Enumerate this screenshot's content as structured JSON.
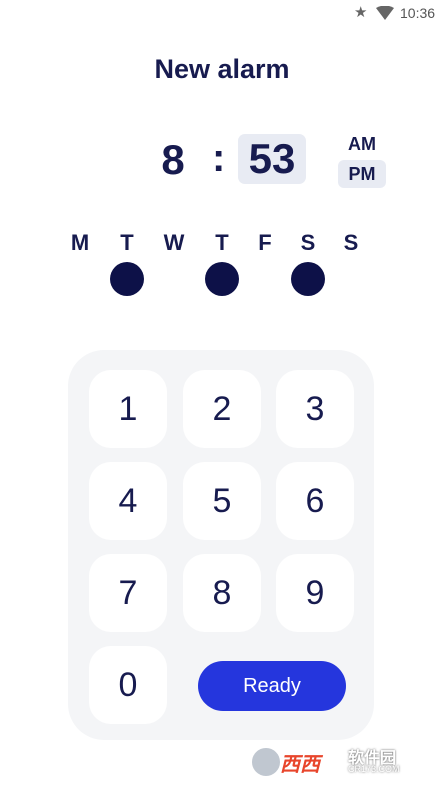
{
  "status_bar": {
    "time": "10:36",
    "icons": [
      "star-icon",
      "wifi-icon"
    ]
  },
  "title": "New alarm",
  "time_picker": {
    "hour": "8",
    "separator": ":",
    "minute": "53",
    "am_label": "AM",
    "pm_label": "PM",
    "selected_period": "PM"
  },
  "days": [
    {
      "label": "M",
      "selected": false
    },
    {
      "label": "T",
      "selected": true
    },
    {
      "label": "W",
      "selected": false
    },
    {
      "label": "T",
      "selected": true
    },
    {
      "label": "F",
      "selected": false
    },
    {
      "label": "S",
      "selected": true
    },
    {
      "label": "S",
      "selected": false
    }
  ],
  "keypad": {
    "keys": [
      "1",
      "2",
      "3",
      "4",
      "5",
      "6",
      "7",
      "8",
      "9",
      "0"
    ],
    "ready_label": "Ready"
  },
  "colors": {
    "accent": "#2536dd",
    "navy": "#171b4f",
    "highlight": "#e8ebf3"
  },
  "watermark": {
    "brand": "西西",
    "site": "软件园",
    "url": "CR173.COM"
  }
}
